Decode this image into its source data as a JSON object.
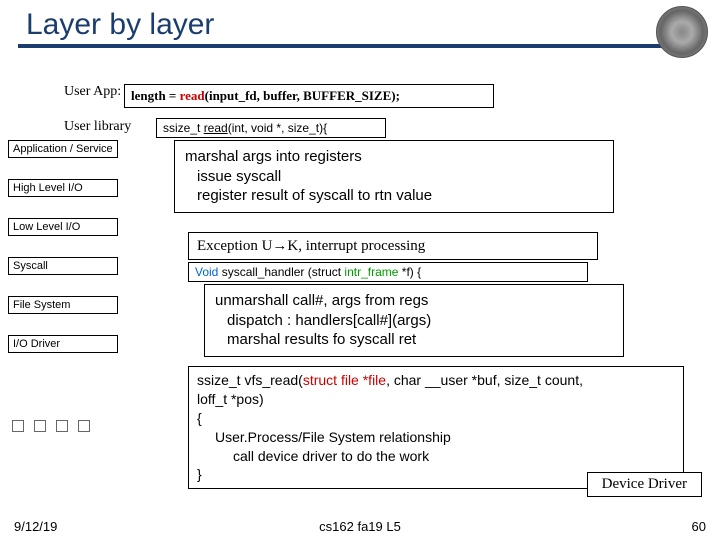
{
  "title": "Layer by layer",
  "ua_label": "User App:",
  "ul_label": "User library",
  "code1": {
    "a": "length = ",
    "b": "read",
    "c": "(input_fd, buffer, BUFFER_SIZE);"
  },
  "code2": {
    "a": "ssize_t ",
    "b": "read",
    "c": "(int, void *, size_t){"
  },
  "box3": {
    "l1": "marshal args into registers",
    "l2": "issue syscall",
    "l3": "register result of syscall to rtn value"
  },
  "box4": {
    "a": "Exception U",
    "b": "→",
    "c": "K, interrupt processing"
  },
  "code5": {
    "a": "Void ",
    "b": "syscall_handler ",
    "c": "(struct ",
    "d": "intr_frame ",
    "e": "*f) {"
  },
  "box6": {
    "l1": "unmarshall call#, args from regs",
    "l2": "dispatch : handlers[call#](args)",
    "l3": "marshal results fo syscall ret"
  },
  "box7": {
    "a": "ssize_t vfs_read(",
    "b": "struct file *file",
    "c": ", char __user *buf, size_t count,",
    "d": "loff_t *pos)",
    "e": "{",
    "f1": "User.Process/File System relationship",
    "f2": "call device driver to do the work",
    "g": "}"
  },
  "dd": "Device Driver",
  "stack": [
    "Application / Service",
    "High Level I/O",
    "Low Level I/O",
    "Syscall",
    "File System",
    "I/O Driver"
  ],
  "foot": {
    "l": "9/12/19",
    "c": "cs162 fa19 L5",
    "r": "60"
  }
}
